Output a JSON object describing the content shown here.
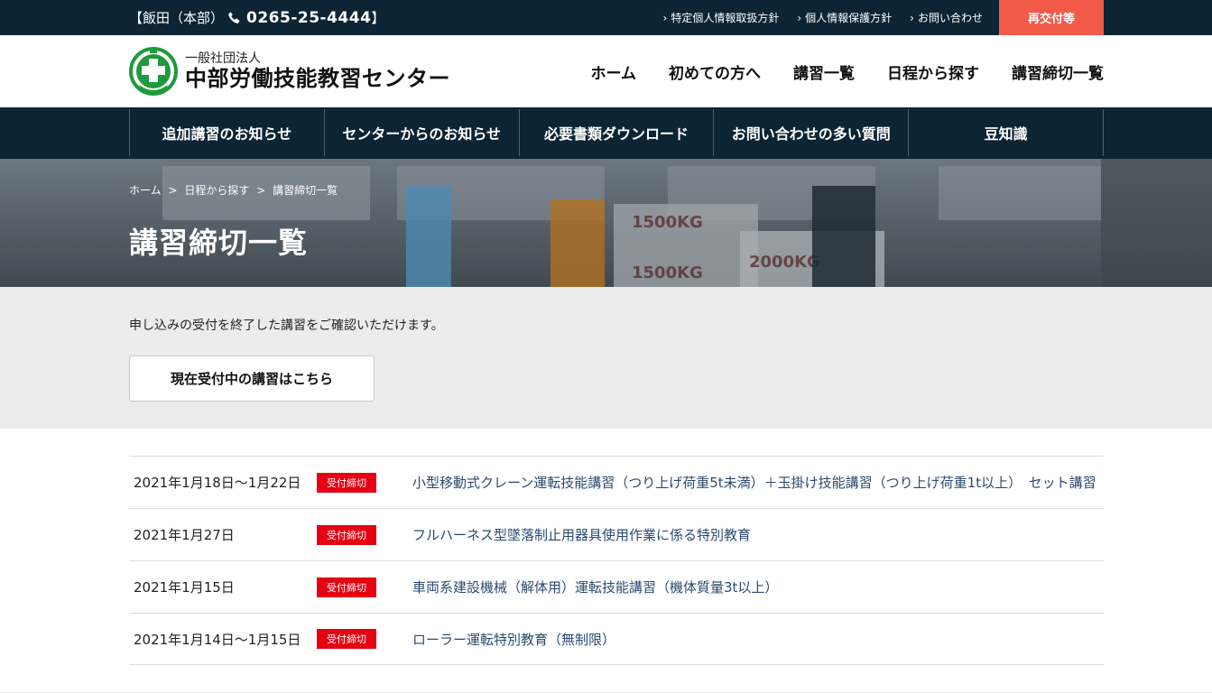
{
  "topbar": {
    "location": "【飯田（本部）",
    "phone": "0265-25-4444",
    "close_bracket": "】",
    "links": [
      "特定個人情報取扱方針",
      "個人情報保護方針",
      "お問い合わせ"
    ],
    "reissue": "再交付等"
  },
  "header": {
    "logo_sub": "一般社団法人",
    "logo_main": "中部労働技能教習センター",
    "nav": [
      "ホーム",
      "初めての方へ",
      "講習一覧",
      "日程から探す",
      "講習締切一覧"
    ]
  },
  "subnav": [
    "追加講習のお知らせ",
    "センターからのお知らせ",
    "必要書類ダウンロード",
    "お問い合わせの多い質問",
    "豆知識"
  ],
  "hero": {
    "breadcrumb": [
      "ホーム",
      ">",
      "日程から探す",
      ">",
      "講習締切一覧"
    ],
    "title": "講習締切一覧",
    "photo_text": [
      "1500KG",
      "1500KG",
      "2000KG"
    ]
  },
  "intro": {
    "text": "申し込みの受付を終了した講習をご確認いただけます。",
    "button": "現在受付中の講習はこちら"
  },
  "courses": [
    {
      "date": "2021年1月18日〜1月22日",
      "status": "受付締切",
      "title": "小型移動式クレーン運転技能講習（つり上げ荷重5t未満）＋玉掛け技能講習（つり上げ荷重1t以上）　セット講習"
    },
    {
      "date": "2021年1月27日",
      "status": "受付締切",
      "title": "フルハーネス型墜落制止用器具使用作業に係る特別教育"
    },
    {
      "date": "2021年1月15日",
      "status": "受付締切",
      "title": "車両系建設機械（解体用）運転技能講習（機体質量3t以上）"
    },
    {
      "date": "2021年1月14日〜1月15日",
      "status": "受付締切",
      "title": "ローラー運転特別教育（無制限）"
    }
  ],
  "colors": {
    "navy": "#0c2433",
    "accent": "#f25a4a",
    "badge": "#e50012",
    "link": "#2a4a70",
    "logo_green": "#1e9a3c"
  }
}
